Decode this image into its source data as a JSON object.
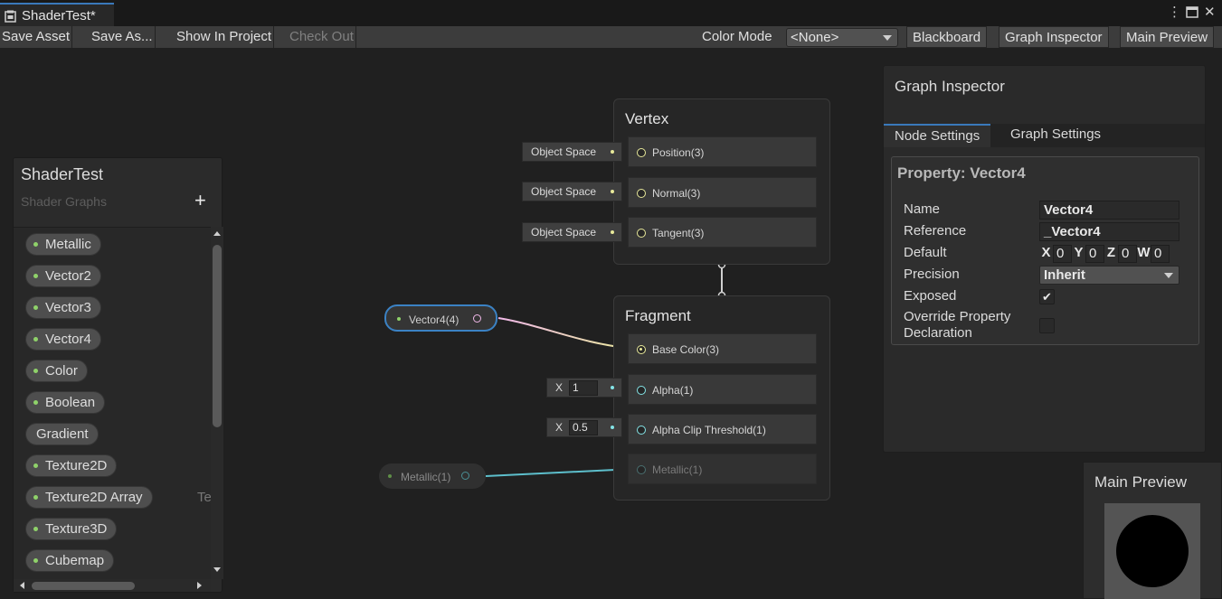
{
  "window": {
    "tab_title": "ShaderTest*",
    "icons": [
      "more-options-icon",
      "maximize-icon",
      "close-icon"
    ],
    "more_glyph": "⋮",
    "maximize_glyph": "🗖",
    "close_glyph": "✕"
  },
  "toolbar": {
    "save_asset": "Save Asset",
    "save_as": "Save As...",
    "show_in_project": "Show In Project",
    "check_out": "Check Out",
    "color_mode_label": "Color Mode",
    "color_mode_value": "<None>",
    "blackboard": "Blackboard",
    "graph_inspector": "Graph Inspector",
    "main_preview": "Main Preview"
  },
  "blackboard": {
    "title": "ShaderTest",
    "subtitle": "Shader Graphs",
    "add_glyph": "+",
    "properties": [
      {
        "label": "Metallic"
      },
      {
        "label": "Vector2"
      },
      {
        "label": "Vector3"
      },
      {
        "label": "Vector4"
      },
      {
        "label": "Color"
      },
      {
        "label": "Boolean"
      },
      {
        "label": "Gradient"
      },
      {
        "label": "Texture2D"
      },
      {
        "label": "Texture2D Array"
      },
      {
        "label": "Texture3D"
      },
      {
        "label": "Cubemap"
      }
    ],
    "clipped_text": "Te"
  },
  "graph": {
    "vertex": {
      "title": "Vertex",
      "slots": [
        "Position(3)",
        "Normal(3)",
        "Tangent(3)"
      ],
      "inputs": [
        "Object Space",
        "Object Space",
        "Object Space"
      ]
    },
    "fragment": {
      "title": "Fragment",
      "slots": [
        "Base Color(3)",
        "Alpha(1)",
        "Alpha Clip Threshold(1)",
        "Metallic(1)"
      ],
      "alpha_axis": "X",
      "alpha_value": "1",
      "clip_axis": "X",
      "clip_value": "0.5"
    },
    "vector4_node": "Vector4(4)",
    "metallic_node": "Metallic(1)",
    "colors": {
      "vector_port": "#e8e99a",
      "float_port": "#84e4e7",
      "vector4_port": "#f0b8e8",
      "selection": "#3b82c4"
    }
  },
  "inspector": {
    "title": "Graph Inspector",
    "tabs": [
      "Node Settings",
      "Graph Settings"
    ],
    "property_title": "Property: Vector4",
    "name_label": "Name",
    "name_value": "Vector4",
    "reference_label": "Reference",
    "reference_value": "_Vector4",
    "default_label": "Default",
    "default": [
      {
        "axis": "X",
        "value": "0"
      },
      {
        "axis": "Y",
        "value": "0"
      },
      {
        "axis": "Z",
        "value": "0"
      },
      {
        "axis": "W",
        "value": "0"
      }
    ],
    "precision_label": "Precision",
    "precision_value": "Inherit",
    "exposed_label": "Exposed",
    "exposed_check": "✔",
    "override_label_1": "Override Property",
    "override_label_2": "Declaration"
  },
  "preview": {
    "title": "Main Preview"
  }
}
